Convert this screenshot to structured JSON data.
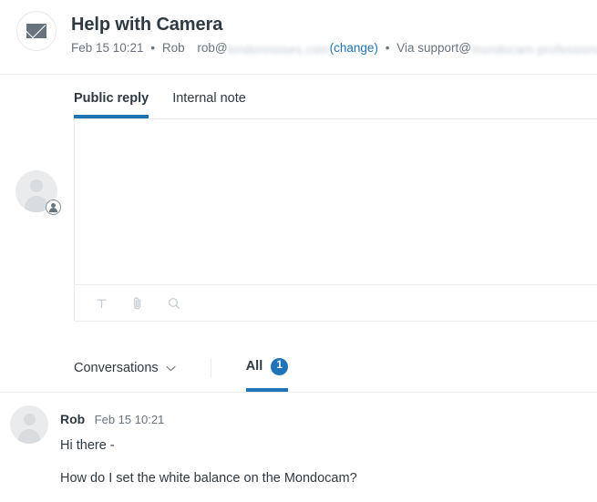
{
  "header": {
    "channel_icon": "envelope-icon",
    "title": "Help with Camera",
    "timestamp": "Feb 15 10:21",
    "separator": "•",
    "requester_name": "Rob",
    "requester_email_prefix": "rob@",
    "requester_email_domain_redacted": "londonnoises.com",
    "change_link": "(change)",
    "via_prefix": "Via support@",
    "via_address_redacted": "mondocam-professional"
  },
  "composer": {
    "avatar_name": "requester-avatar",
    "avatar_badge_icon": "person-circle-icon",
    "tabs": [
      {
        "label": "Public reply",
        "active": true
      },
      {
        "label": "Internal note",
        "active": false
      }
    ],
    "editor_value": "",
    "editor_placeholder": "",
    "toolbar": [
      {
        "icon": "text-format-icon",
        "label": "T"
      },
      {
        "icon": "paperclip-icon",
        "label": "Attach"
      },
      {
        "icon": "search-icon",
        "label": "Search"
      }
    ]
  },
  "conversations": {
    "select_label": "Conversations",
    "chevron_icon": "chevron-down-icon",
    "filter_label": "All",
    "filter_count": "1"
  },
  "messages": [
    {
      "author": "Rob",
      "time": "Feb 15 10:21",
      "lines": [
        "Hi there -",
        "How do I set the white balance on the Mondocam?"
      ]
    }
  ],
  "colors": {
    "accent": "#1f73b7",
    "text": "#2f3941",
    "muted": "#68737d",
    "border": "#e9ebed"
  }
}
